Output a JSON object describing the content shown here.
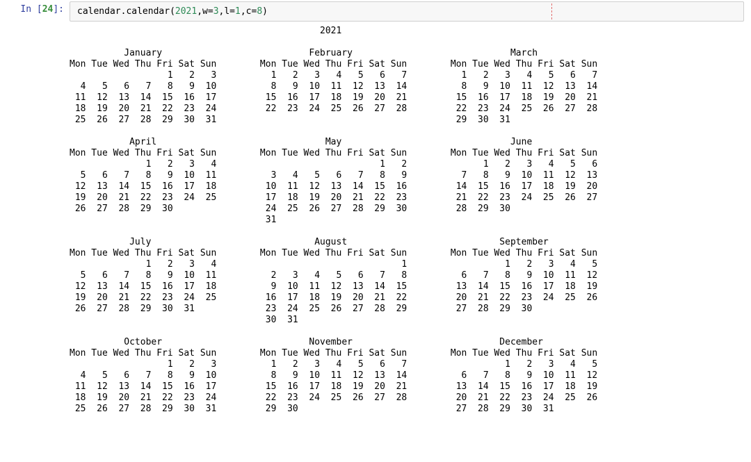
{
  "cell": {
    "prompt_in": "In ",
    "prompt_open": "[",
    "prompt_num": "24",
    "prompt_close": "]:",
    "code": {
      "func": "calendar.calendar",
      "open": "(",
      "arg_year": "2021",
      "comma1": ",",
      "w_key": "w",
      "eq1": "=",
      "w_val": "3",
      "comma2": ",",
      "l_key": "l",
      "eq2": "=",
      "l_val": "1",
      "comma3": ",",
      "c_key": "c",
      "eq3": "=",
      "c_val": "8",
      "close": ")"
    }
  },
  "calendar": {
    "year": 2021,
    "w": 3,
    "l": 1,
    "c": 8,
    "day_header": [
      "Mon",
      "Tue",
      "Wed",
      "Thu",
      "Fri",
      "Sat",
      "Sun"
    ],
    "months": [
      {
        "name": "January",
        "first_weekday": 4,
        "days": 31
      },
      {
        "name": "February",
        "first_weekday": 0,
        "days": 28
      },
      {
        "name": "March",
        "first_weekday": 0,
        "days": 31
      },
      {
        "name": "April",
        "first_weekday": 3,
        "days": 30
      },
      {
        "name": "May",
        "first_weekday": 5,
        "days": 31
      },
      {
        "name": "June",
        "first_weekday": 1,
        "days": 30
      },
      {
        "name": "July",
        "first_weekday": 3,
        "days": 31
      },
      {
        "name": "August",
        "first_weekday": 6,
        "days": 31
      },
      {
        "name": "September",
        "first_weekday": 2,
        "days": 30
      },
      {
        "name": "October",
        "first_weekday": 4,
        "days": 31
      },
      {
        "name": "November",
        "first_weekday": 0,
        "days": 30
      },
      {
        "name": "December",
        "first_weekday": 2,
        "days": 31
      }
    ]
  }
}
